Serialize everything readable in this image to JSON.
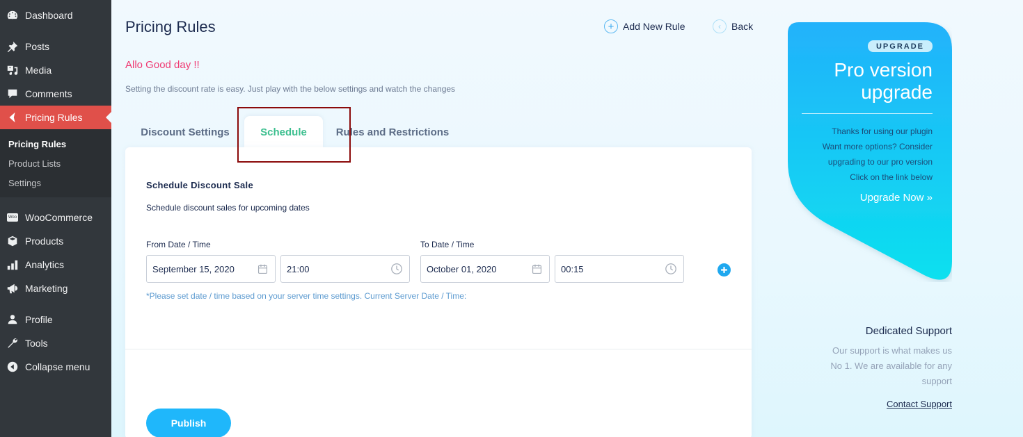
{
  "sidebar": {
    "items": [
      {
        "label": "Dashboard",
        "icon": "dashboard-icon"
      },
      {
        "label": "Posts",
        "icon": "pin-icon"
      },
      {
        "label": "Media",
        "icon": "media-icon"
      },
      {
        "label": "Comments",
        "icon": "comment-icon"
      },
      {
        "label": "Pricing Rules",
        "icon": "chevron-left-icon",
        "active": true
      },
      {
        "label": "WooCommerce",
        "icon": "woo-icon"
      },
      {
        "label": "Products",
        "icon": "box-icon"
      },
      {
        "label": "Analytics",
        "icon": "bar-chart-icon"
      },
      {
        "label": "Marketing",
        "icon": "megaphone-icon"
      },
      {
        "label": "Profile",
        "icon": "user-icon"
      },
      {
        "label": "Tools",
        "icon": "wrench-icon"
      },
      {
        "label": "Collapse menu",
        "icon": "collapse-icon"
      }
    ],
    "submenu": [
      {
        "label": "Pricing Rules",
        "current": true
      },
      {
        "label": "Product Lists"
      },
      {
        "label": "Settings"
      }
    ],
    "woo_badge": "Woo"
  },
  "header": {
    "title": "Pricing Rules",
    "greeting": "Allo Good day !!",
    "intro": "Setting the discount rate is easy. Just play with the below settings and watch the changes",
    "add_new_rule": "Add New Rule",
    "back": "Back"
  },
  "tabs": [
    {
      "label": "Discount Settings"
    },
    {
      "label": "Schedule",
      "active": true
    },
    {
      "label": "Rules and Restrictions"
    }
  ],
  "schedule": {
    "title": "Schedule Discount Sale",
    "description": "Schedule discount sales for upcoming dates",
    "from_label": "From Date / Time",
    "to_label": "To Date / Time",
    "from_date": "September 15, 2020",
    "from_time": "21:00",
    "to_date": "October 01, 2020",
    "to_time": "00:15",
    "note": "*Please set date / time based on your server time settings. Current Server Date / Time:"
  },
  "actions": {
    "publish": "Publish"
  },
  "promo": {
    "badge": "UPGRADE",
    "title_line1": "Pro version",
    "title_line2": "upgrade",
    "text_lines": [
      "Thanks for using our plugin",
      "Want more options? Consider",
      "upgrading to our pro version",
      "Click on the link below"
    ],
    "link": "Upgrade Now »"
  },
  "support": {
    "title": "Dedicated Support",
    "text_lines": [
      "Our support is what makes us",
      "No 1. We are available for any",
      "support"
    ],
    "link": "Contact Support"
  },
  "colors": {
    "sidebar_bg": "#32373c",
    "active_menu": "#e0504a",
    "accent_blue": "#1fb7fb",
    "active_tab_text": "#3cbf8f",
    "greeting": "#ef3a73",
    "highlight_box": "#8b0a0a"
  }
}
